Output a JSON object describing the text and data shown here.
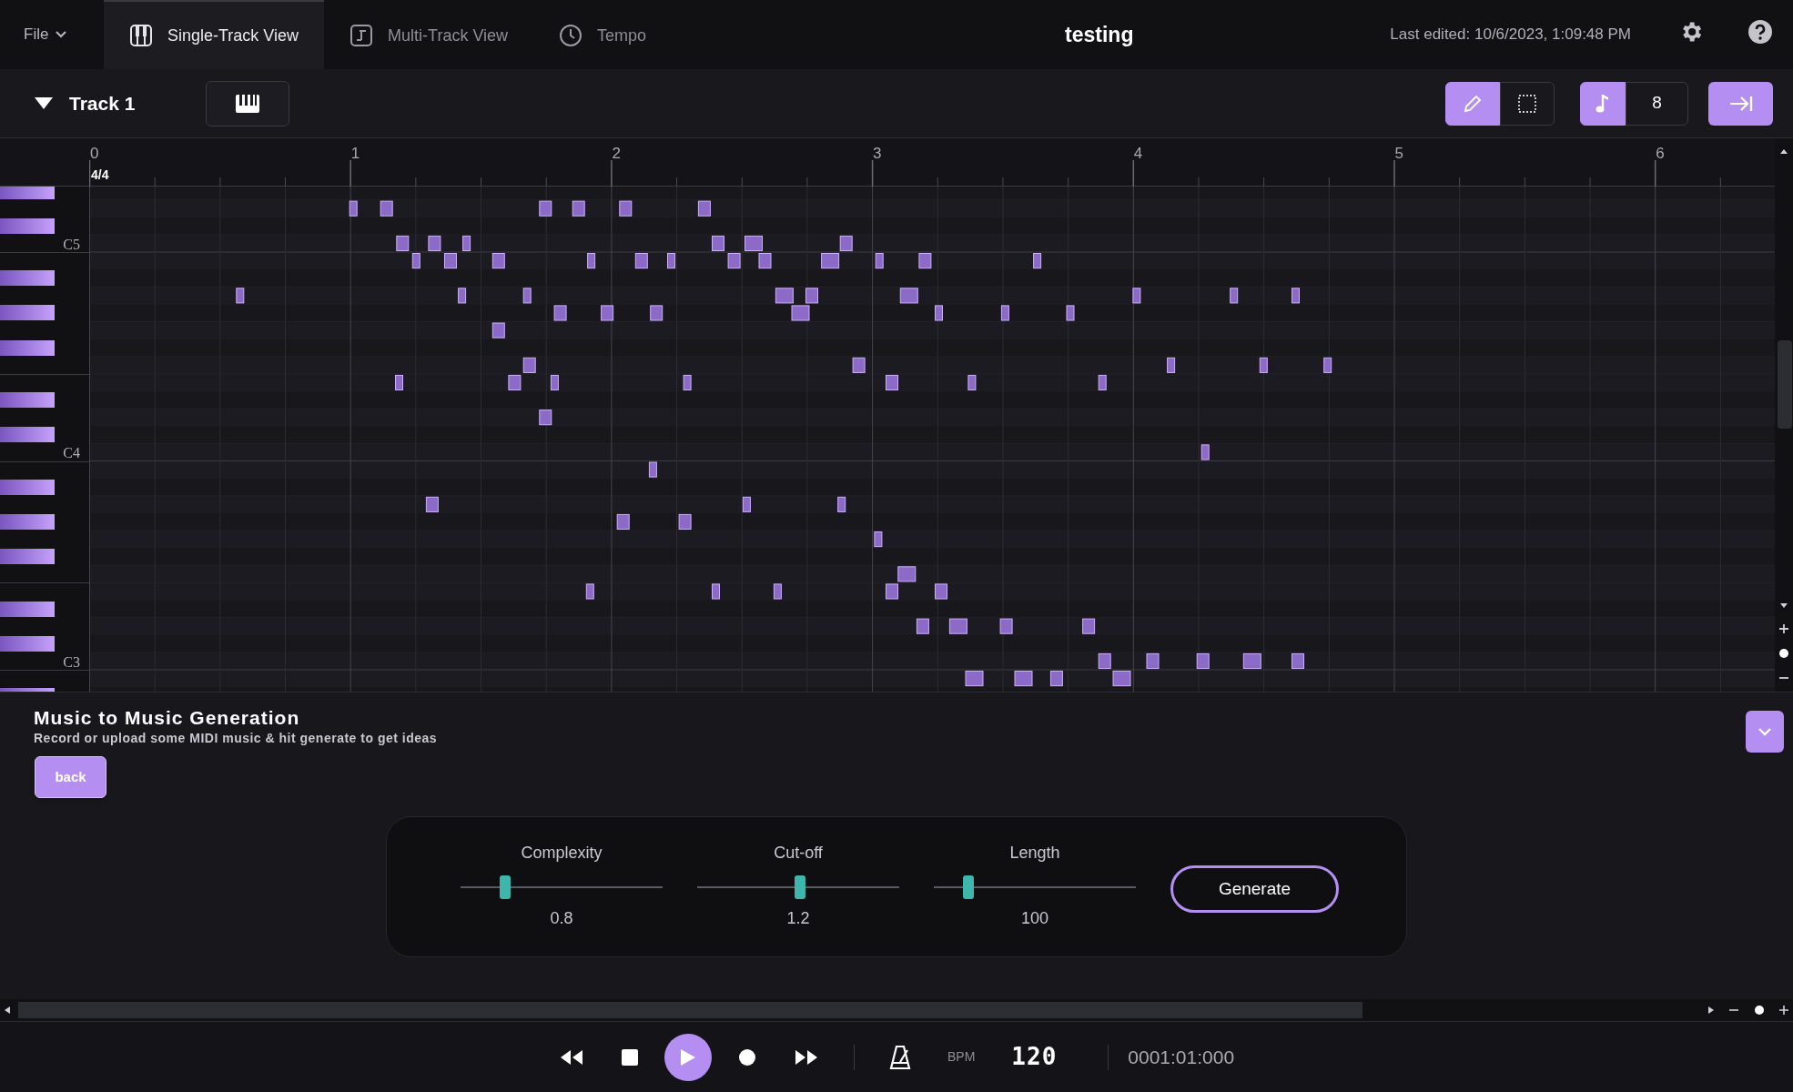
{
  "header": {
    "file_menu": "File",
    "title": "testing",
    "last_edited": "Last edited: 10/6/2023, 1:09:48 PM"
  },
  "tabs": [
    {
      "label": "Single-Track View",
      "selected": true
    },
    {
      "label": "Multi-Track View",
      "selected": false
    },
    {
      "label": "Tempo",
      "selected": false
    }
  ],
  "track": {
    "name": "Track 1",
    "expanded": true
  },
  "tools": [
    {
      "selected": true
    },
    {
      "selected": false
    }
  ],
  "note_snap": {
    "on": true,
    "value": "8"
  },
  "end_button": {
    "on": true
  },
  "ruler": {
    "bars": [
      "0",
      "1",
      "2",
      "3",
      "4",
      "5",
      "6"
    ],
    "time_signature": "4/4"
  },
  "pitch_labels": [
    "C5",
    "C4",
    "C3"
  ],
  "generation_panel": {
    "title": "Music to Music Generation",
    "subtitle": "Record or upload some MIDI music & hit generate to get ideas",
    "back_button": "back",
    "sliders": [
      {
        "label": "Complexity",
        "level": 0.22,
        "value": "0.8"
      },
      {
        "label": "Cut-off",
        "level": 0.51,
        "value": "1.2"
      },
      {
        "label": "Length",
        "level": 0.17,
        "value": "100"
      }
    ],
    "generate_button": "Generate"
  },
  "transport": {
    "bpm_label": "BPM",
    "bpm": "120",
    "time": "0001:01:000"
  }
}
